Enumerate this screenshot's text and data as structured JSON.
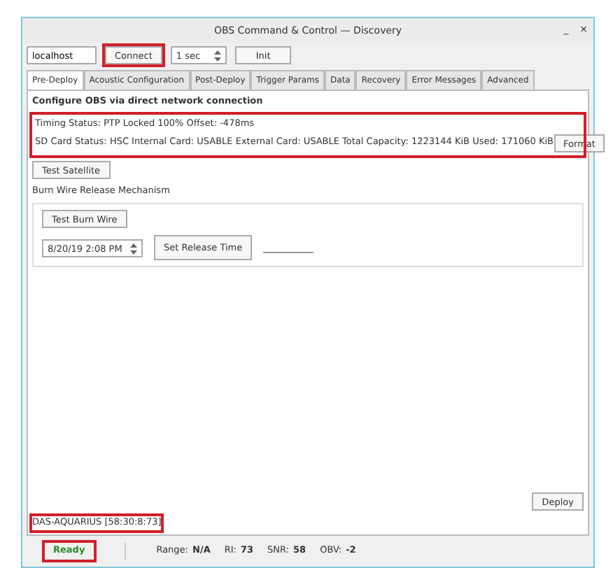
{
  "window": {
    "title": "OBS Command & Control — Discovery",
    "controls": [
      "_",
      "×"
    ]
  },
  "toolbar": {
    "host": {
      "value": "localhost"
    },
    "connect": {
      "label": "Connect",
      "highlighted": true
    },
    "interval": {
      "value": "1 sec"
    },
    "init": {
      "label": "Init"
    }
  },
  "tabs": [
    {
      "label": "Pre-Deploy",
      "selected": true
    },
    {
      "label": "Acoustic Configuration",
      "selected": false
    },
    {
      "label": "Post-Deploy",
      "selected": false
    },
    {
      "label": "Trigger Params",
      "selected": false
    },
    {
      "label": "Data",
      "selected": false
    },
    {
      "label": "Recovery",
      "selected": false
    },
    {
      "label": "Error Messages",
      "selected": false
    },
    {
      "label": "Advanced",
      "selected": false
    }
  ],
  "heading": "Configure OBS via direct network connection",
  "status_panel": {
    "highlighted": true,
    "timing": "Timing Status: PTP Locked 100% Offset: -478ms",
    "sd_card": "SD Card Status: HSC Internal Card: USABLE External Card: USABLE Total Capacity: 1223144 KiB Used: 171060 KiB",
    "format_button": "Format"
  },
  "test_satellite": "Test Satellite",
  "burn_wire": {
    "title": "Burn Wire Release Mechanism",
    "test_button": "Test Burn Wire",
    "datetime": "8/20/19 2:08 PM",
    "set_button": "Set Release Time"
  },
  "deploy_button": "Deploy",
  "device": {
    "label": "DAS-AQUARIUS [58:30:8:73]",
    "highlighted": true
  },
  "status_bar": {
    "ready": {
      "label": "Ready",
      "highlighted": true
    },
    "items": [
      {
        "label": "Range:",
        "value": "N/A"
      },
      {
        "label": "RI:",
        "value": "73"
      },
      {
        "label": "SNR:",
        "value": "58"
      },
      {
        "label": "OBV:",
        "value": "-2"
      }
    ]
  }
}
